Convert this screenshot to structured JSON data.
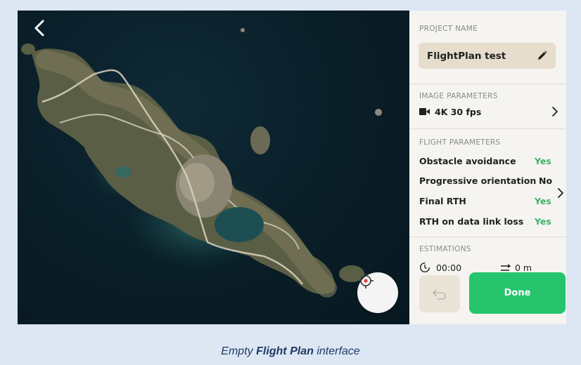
{
  "map": {
    "back_icon": "chevron-left-icon",
    "locate_icon": "crosshair-target-icon"
  },
  "panel": {
    "project_name_label": "PROJECT NAME",
    "project_name": "FlightPlan test",
    "edit_icon": "pencil-icon",
    "image_parameters_label": "IMAGE PARAMETERS",
    "image_parameters_value": "4K 30 fps",
    "video_icon": "video-camera-icon",
    "flight_parameters_label": "FLIGHT PARAMETERS",
    "flight_parameters": [
      {
        "label": "Obstacle avoidance",
        "value": "Yes",
        "color": "#3bb36d"
      },
      {
        "label": "Progressive orientation",
        "value": "No",
        "color": "#202020"
      },
      {
        "label": "Final RTH",
        "value": "Yes",
        "color": "#3bb36d"
      },
      {
        "label": "RTH on data link loss",
        "value": "Yes",
        "color": "#3bb36d"
      }
    ],
    "estimations_label": "ESTIMATIONS",
    "estimation_time": "00:00",
    "estimation_distance": "0 m",
    "undo_icon": "undo-icon",
    "done_label": "Done"
  },
  "caption": {
    "prefix": "Empty ",
    "bold": "Flight Plan",
    "suffix": " interface"
  },
  "colors": {
    "accent_green": "#27c46e",
    "name_box": "#e6ddcd",
    "caption_blue": "#1f3a66"
  }
}
